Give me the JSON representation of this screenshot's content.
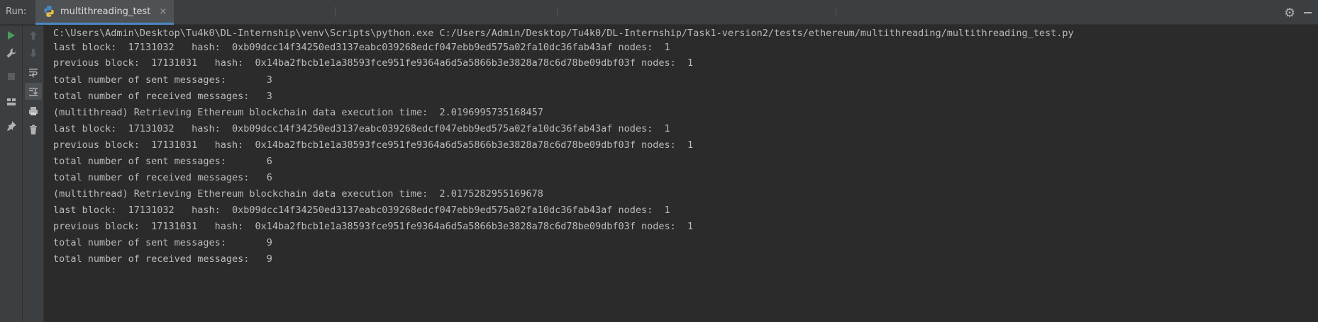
{
  "run_panel": {
    "label": "Run:",
    "tab_label": "multithreading_test",
    "tab_close": "×"
  },
  "console": {
    "lines": [
      "C:\\Users\\Admin\\Desktop\\Tu4k0\\DL-Internship\\venv\\Scripts\\python.exe C:/Users/Admin/Desktop/Tu4k0/DL-Internship/Task1-version2/tests/ethereum/multithreading/multithreading_test.py",
      "last block:  17131032   hash:  0xb09dcc14f34250ed3137eabc039268edcf047ebb9ed575a02fa10dc36fab43af nodes:  1",
      "previous block:  17131031   hash:  0x14ba2fbcb1e1a38593fce951fe9364a6d5a5866b3e3828a78c6d78be09dbf03f nodes:  1",
      "total number of sent messages:       3",
      "total number of received messages:   3",
      "(multithread) Retrieving Ethereum blockchain data execution time:  2.0196995735168457",
      "last block:  17131032   hash:  0xb09dcc14f34250ed3137eabc039268edcf047ebb9ed575a02fa10dc36fab43af nodes:  1",
      "previous block:  17131031   hash:  0x14ba2fbcb1e1a38593fce951fe9364a6d5a5866b3e3828a78c6d78be09dbf03f nodes:  1",
      "total number of sent messages:       6",
      "total number of received messages:   6",
      "(multithread) Retrieving Ethereum blockchain data execution time:  2.0175282955169678",
      "last block:  17131032   hash:  0xb09dcc14f34250ed3137eabc039268edcf047ebb9ed575a02fa10dc36fab43af nodes:  1",
      "previous block:  17131031   hash:  0x14ba2fbcb1e1a38593fce951fe9364a6d5a5866b3e3828a78c6d78be09dbf03f nodes:  1",
      "total number of sent messages:       9",
      "total number of received messages:   9"
    ]
  },
  "toolbar_icons": {
    "left": [
      "rerun-icon",
      "settings-wrench-icon",
      "stop-icon",
      "layout-icon",
      "pin-icon"
    ],
    "right": [
      "arrow-up-icon",
      "arrow-down-icon",
      "soft-wrap-icon",
      "scroll-to-end-icon",
      "print-icon",
      "trash-icon"
    ]
  },
  "colors": {
    "background": "#2b2b2b",
    "panel": "#3c3f41",
    "tab_active": "#4e5254",
    "accent": "#4a88c7",
    "run_green": "#499c54"
  }
}
